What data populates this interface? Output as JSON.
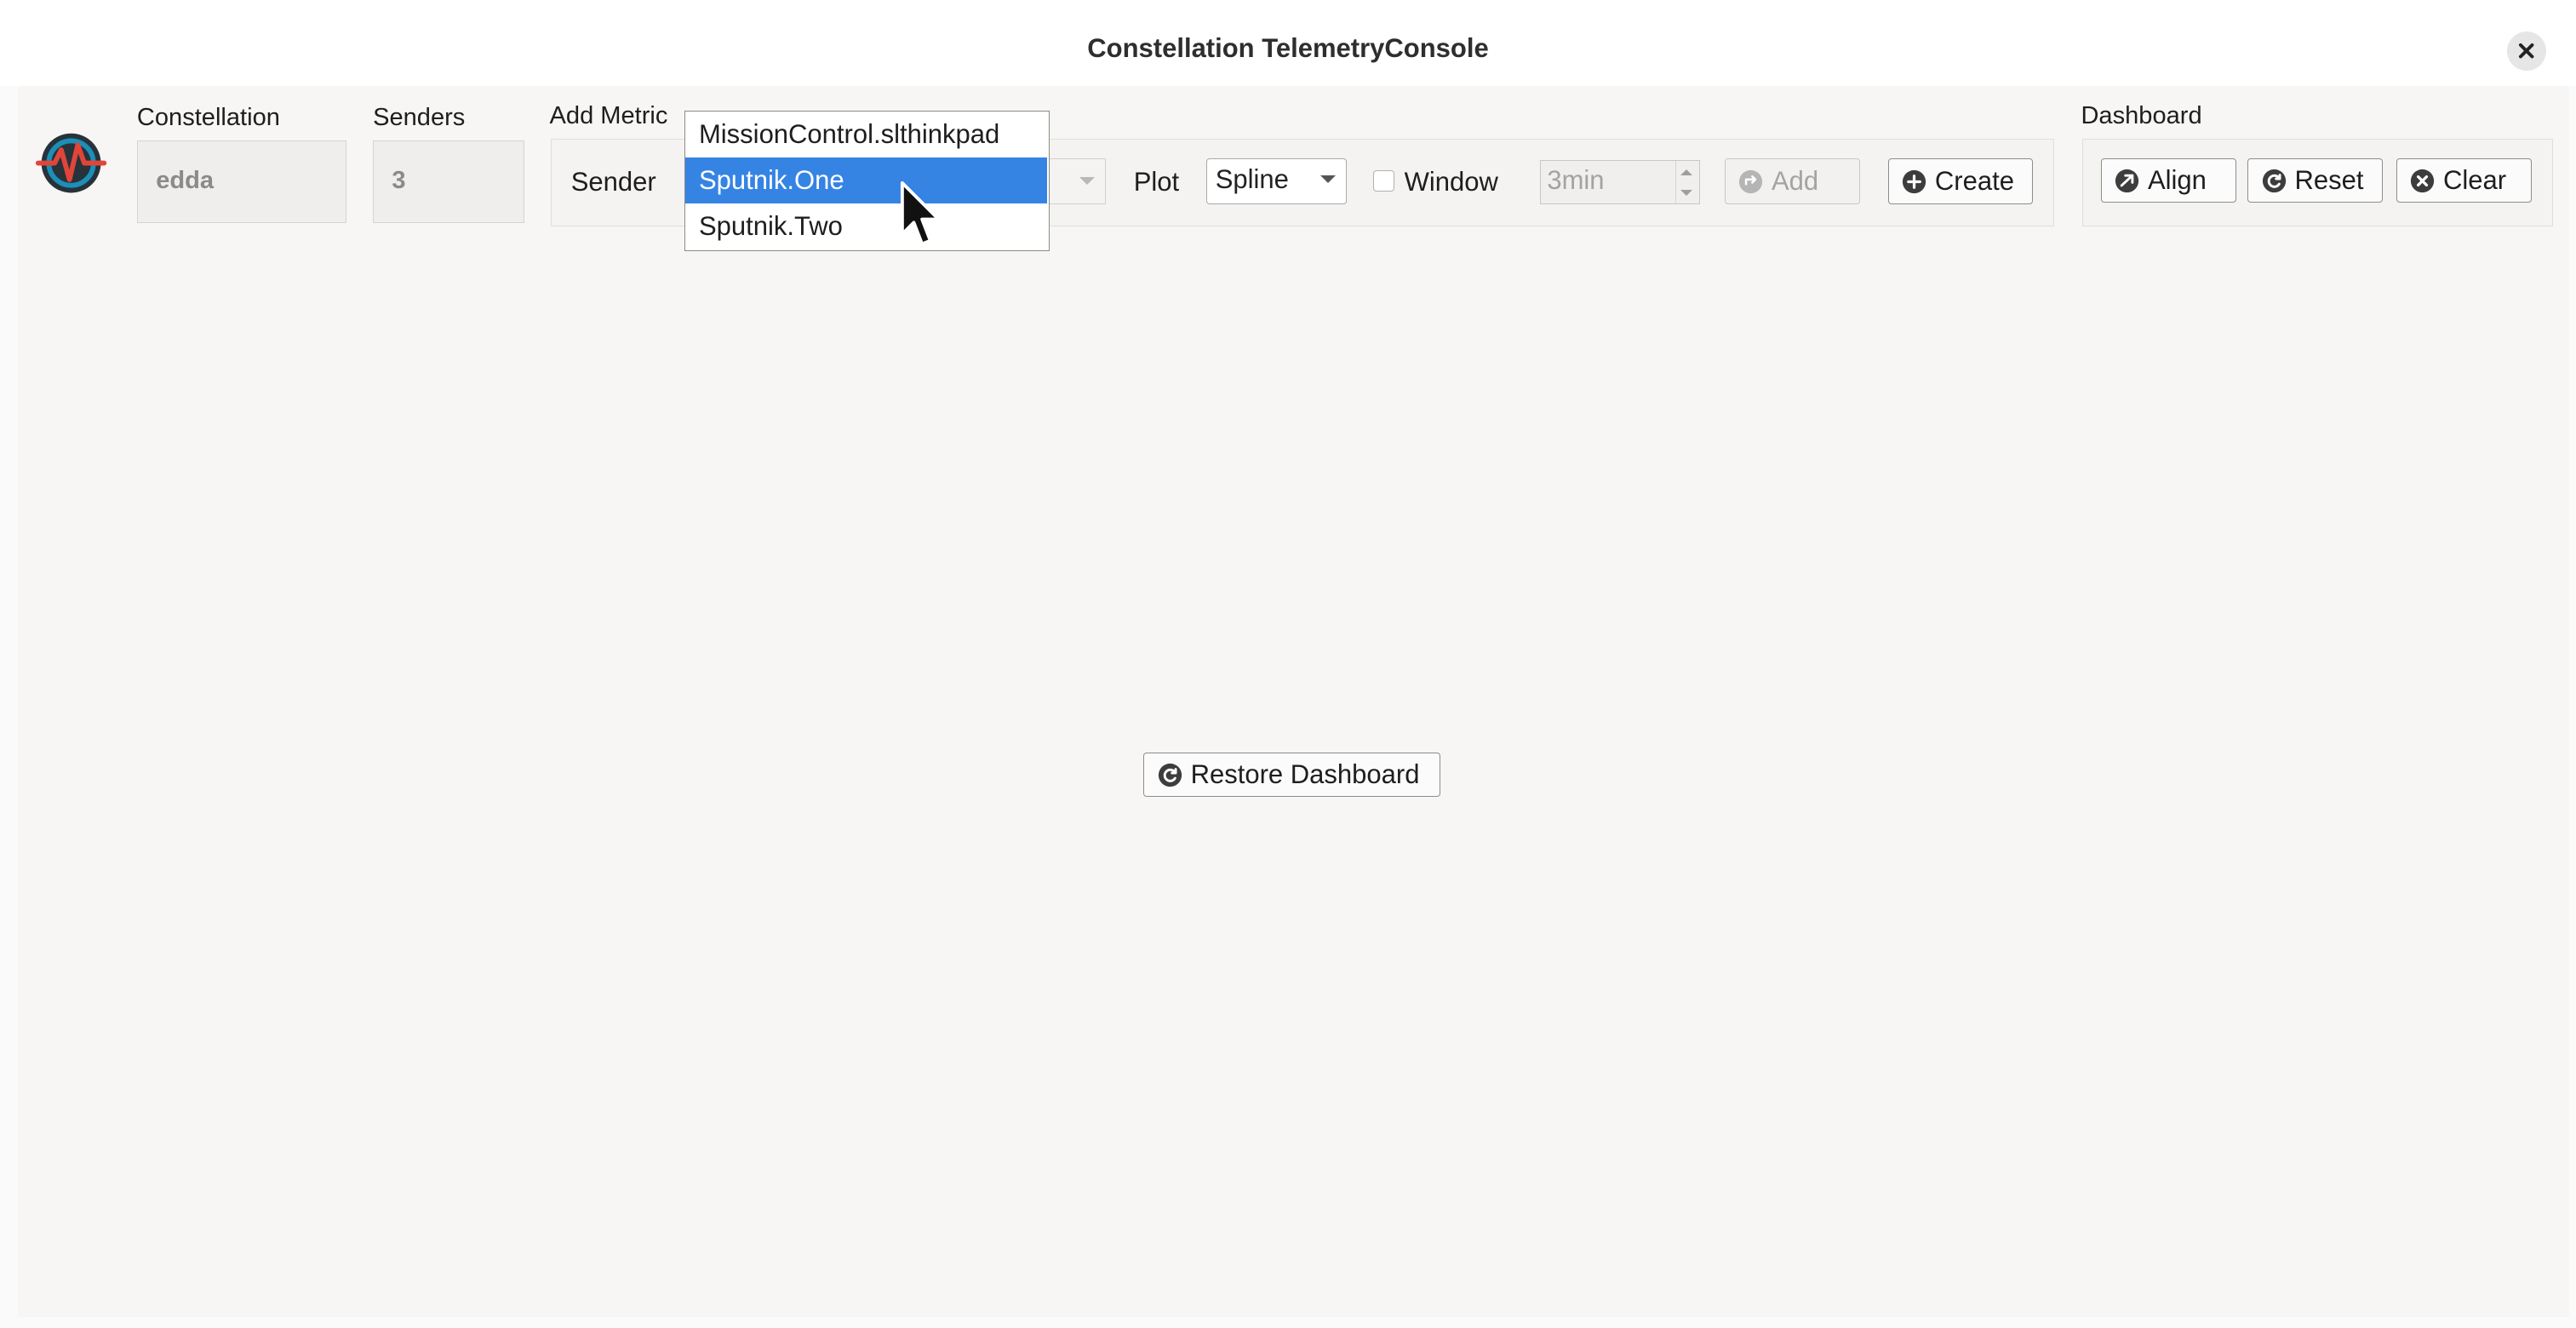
{
  "window": {
    "title": "Constellation TelemetryConsole"
  },
  "header": {
    "constellation_label": "Constellation",
    "constellation_value": "edda",
    "senders_label": "Senders",
    "senders_value": "3"
  },
  "add_metric": {
    "group_label": "Add Metric",
    "sender_label": "Sender",
    "plot_label": "Plot",
    "plot_value": "Spline",
    "window_label": "Window",
    "window_checked": false,
    "window_value": "3min",
    "add_button": "Add",
    "create_button": "Create"
  },
  "dashboard": {
    "group_label": "Dashboard",
    "align_button": "Align",
    "reset_button": "Reset",
    "clear_button": "Clear"
  },
  "sender_dropdown": {
    "options": [
      "MissionControl.slthinkpad",
      "Sputnik.One",
      "Sputnik.Two"
    ],
    "selected": "Sputnik.One"
  },
  "main": {
    "restore_button": "Restore Dashboard"
  },
  "colors": {
    "accent": "#3584e4",
    "logo_ring": "#1c8fb8",
    "logo_pulse": "#e0453a"
  },
  "icons": {
    "close": "close-icon",
    "logo": "telemetry-logo-icon",
    "add": "add-icon",
    "create": "plus-circle-icon",
    "align": "align-icon",
    "reset": "refresh-icon",
    "clear": "clear-icon",
    "restore": "refresh-icon"
  }
}
